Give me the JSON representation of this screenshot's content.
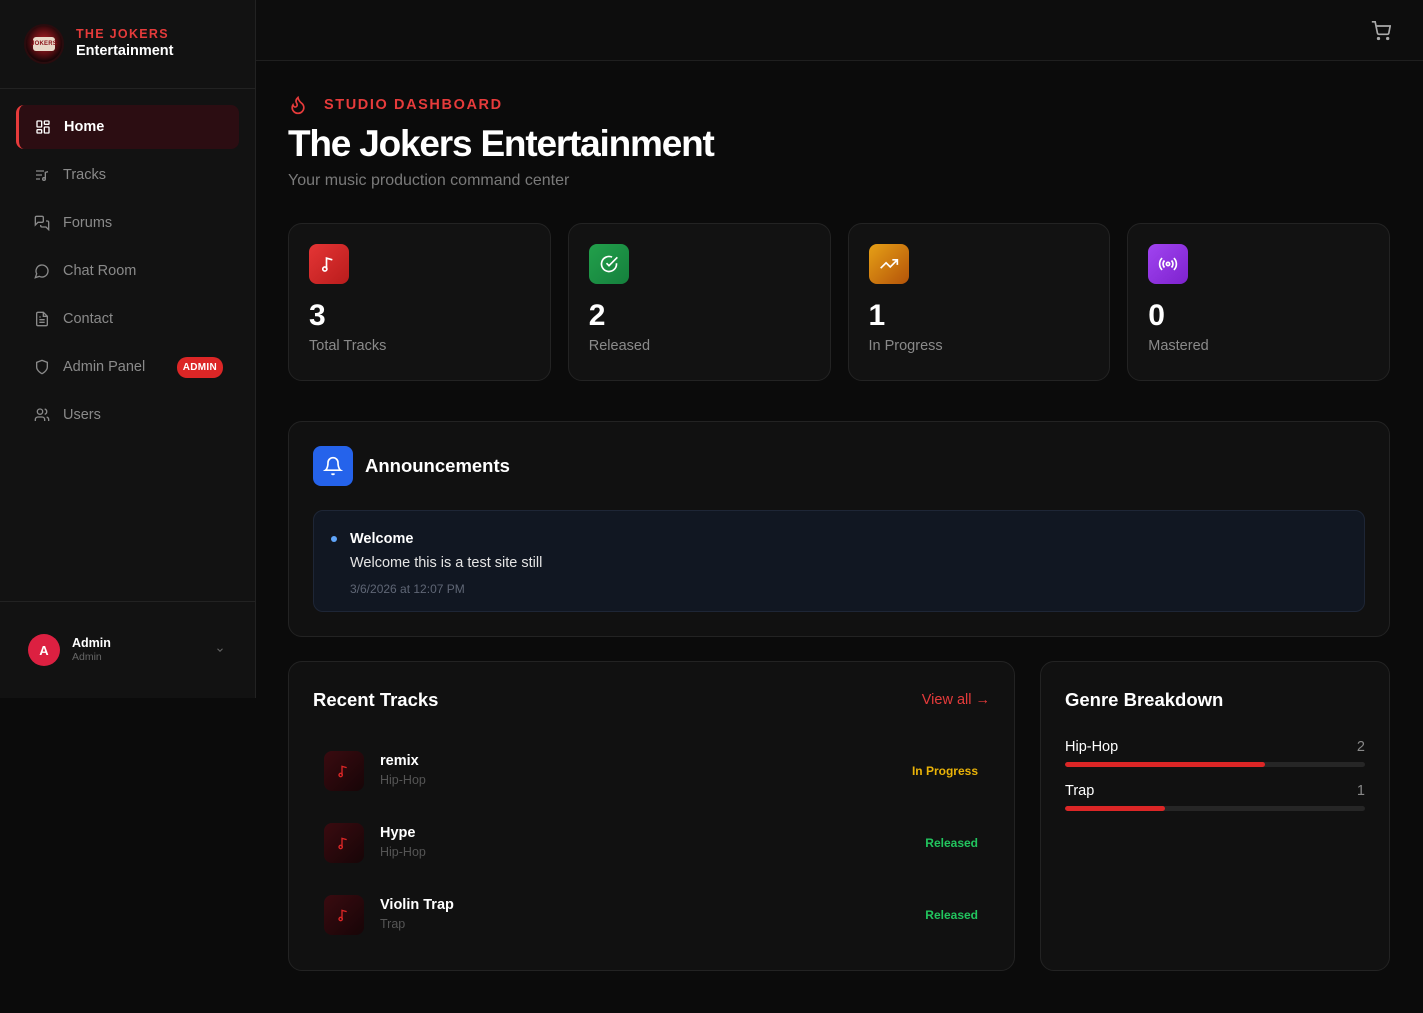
{
  "brand": {
    "top": "THE JOKERS",
    "bottom": "Entertainment",
    "logo_text": "JOKERS"
  },
  "nav": [
    {
      "label": "Home",
      "icon": "grid-icon",
      "active": true
    },
    {
      "label": "Tracks",
      "icon": "list-music-icon"
    },
    {
      "label": "Forums",
      "icon": "messages-icon"
    },
    {
      "label": "Chat Room",
      "icon": "chat-bubble-icon"
    },
    {
      "label": "Contact",
      "icon": "document-icon"
    },
    {
      "label": "Admin Panel",
      "icon": "shield-icon",
      "badge": "ADMIN"
    },
    {
      "label": "Users",
      "icon": "users-icon"
    }
  ],
  "user": {
    "initial": "A",
    "name": "Admin",
    "role": "Admin"
  },
  "header": {
    "eyebrow": "STUDIO DASHBOARD",
    "title": "The Jokers Entertainment",
    "subtitle": "Your music production command center"
  },
  "stats": [
    {
      "value": "3",
      "label": "Total Tracks",
      "color": "#dc2626"
    },
    {
      "value": "2",
      "label": "Released",
      "color": "#16a34a"
    },
    {
      "value": "1",
      "label": "In Progress",
      "color": "#d97706"
    },
    {
      "value": "0",
      "label": "Mastered",
      "color": "#9333ea"
    }
  ],
  "announcements": {
    "title": "Announcements",
    "items": [
      {
        "title": "Welcome",
        "body": "Welcome this is a test site still",
        "time": "3/6/2026 at 12:07 PM"
      }
    ]
  },
  "recent_tracks": {
    "title": "Recent Tracks",
    "view_all": "View all →",
    "items": [
      {
        "name": "remix",
        "genre": "Hip-Hop",
        "status": "In Progress"
      },
      {
        "name": "Hype",
        "genre": "Hip-Hop",
        "status": "Released"
      },
      {
        "name": "Violin Trap",
        "genre": "Trap",
        "status": "Released"
      }
    ]
  },
  "genre_breakdown": {
    "title": "Genre Breakdown",
    "items": [
      {
        "name": "Hip-Hop",
        "count": "2",
        "fraction": 0.667
      },
      {
        "name": "Trap",
        "count": "1",
        "fraction": 0.333
      }
    ]
  },
  "colors": {
    "accent": "#e63b3b",
    "in_progress": "#eab308",
    "released": "#22c55e",
    "bell": "#2563eb"
  }
}
